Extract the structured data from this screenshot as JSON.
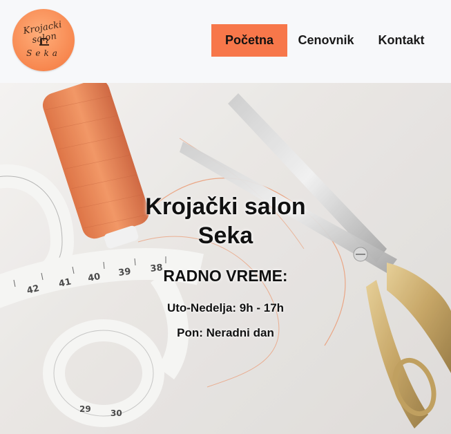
{
  "logo": {
    "line1": "Krojacki salon",
    "line2": "Seka",
    "icon": "sewing-machine-icon"
  },
  "nav": {
    "items": [
      {
        "label": "Početna",
        "active": true
      },
      {
        "label": "Cenovnik",
        "active": false
      },
      {
        "label": "Kontakt",
        "active": false
      }
    ]
  },
  "hero": {
    "title_line1": "Krojački salon",
    "title_line2": "Seka",
    "subtitle": "RADNO VREME:",
    "hours_line1": "Uto-Nedelja: 9h - 17h",
    "hours_line2": "Pon: Neradni dan"
  },
  "colors": {
    "accent": "#f7774a",
    "header_bg": "#f7f8fa",
    "text": "#111111"
  }
}
